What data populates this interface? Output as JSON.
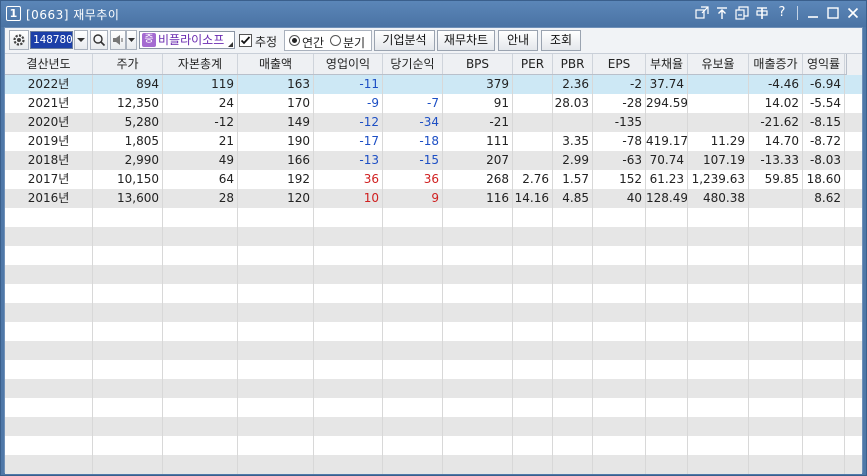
{
  "window": {
    "number": "1",
    "title": "[0663] 재무추이"
  },
  "title_icons": [
    "link-icon",
    "pin-icon",
    "copy-window-icon",
    "print-icon",
    "help-icon",
    "minimize-icon",
    "maximize-icon",
    "close-icon"
  ],
  "toolbar": {
    "code": "148780",
    "name_badge": "증",
    "name": "비플라이소프",
    "estimate_checked": true,
    "estimate_label": "추정",
    "radio_annual": "연간",
    "radio_quarter": "분기",
    "radio_selected": "annual",
    "btn_corp": "기업분석",
    "btn_fin": "재무차트",
    "btn_guide": "안내",
    "btn_query": "조회"
  },
  "table": {
    "columns": [
      "결산년도",
      "주가",
      "자본총계",
      "매출액",
      "영업이익",
      "당기순익",
      "BPS",
      "PER",
      "PBR",
      "EPS",
      "부채율",
      "유보율",
      "매출증가",
      "영익률"
    ],
    "rows": [
      [
        "2022년",
        "894",
        "119",
        "163",
        "-11",
        "",
        "379",
        "",
        "2.36",
        "-2",
        "37.74",
        "",
        "-4.46",
        "-6.94"
      ],
      [
        "2021년",
        "12,350",
        "24",
        "170",
        "-9",
        "-7",
        "91",
        "",
        "28.03",
        "-28",
        "294.59",
        "",
        "14.02",
        "-5.54"
      ],
      [
        "2020년",
        "5,280",
        "-12",
        "149",
        "-12",
        "-34",
        "-21",
        "",
        "",
        "-135",
        "",
        "",
        "-21.62",
        "-8.15"
      ],
      [
        "2019년",
        "1,805",
        "21",
        "190",
        "-17",
        "-18",
        "111",
        "",
        "3.35",
        "-78",
        "419.17",
        "11.29",
        "14.70",
        "-8.72"
      ],
      [
        "2018년",
        "2,990",
        "49",
        "166",
        "-13",
        "-15",
        "207",
        "",
        "2.99",
        "-63",
        "70.74",
        "107.19",
        "-13.33",
        "-8.03"
      ],
      [
        "2017년",
        "10,150",
        "64",
        "192",
        "36",
        "36",
        "268",
        "2.76",
        "1.57",
        "152",
        "61.23",
        "1,239.63",
        "59.85",
        "18.60"
      ],
      [
        "2016년",
        "13,600",
        "28",
        "120",
        "10",
        "9",
        "116",
        "14.16",
        "4.85",
        "40",
        "128.49",
        "480.38",
        "",
        "8.62"
      ]
    ],
    "selected_row": 0
  },
  "colors": {
    "negative": "#1d4fc4",
    "positive": "#d02020",
    "selected_row": "#cde8f5",
    "title_bar": "#4f78a8"
  }
}
